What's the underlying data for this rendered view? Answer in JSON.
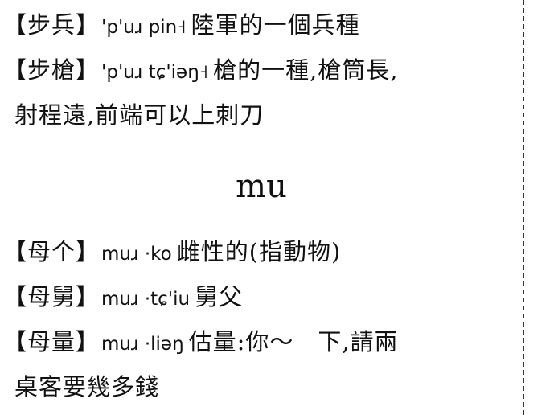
{
  "entries_top": [
    {
      "headword": "【步兵】",
      "pron": "'p'uɹ  pin˧",
      "gloss": "陸軍的一個兵種"
    },
    {
      "headword": "【步槍】",
      "pron": "'p'uɹ  tɕ'iəŋ˧",
      "gloss": "槍的一種,槍筒長,"
    }
  ],
  "entry2_cont": "射程遠,前端可以上刺刀",
  "section_heading": "mu",
  "entries_mu": [
    {
      "headword": "【母个】",
      "pron": "muɹ  ·ko",
      "gloss": "雌性的(指動物)"
    },
    {
      "headword": "【母舅】",
      "pron": "muɹ  ·tɕ'iu",
      "gloss": "舅父"
    },
    {
      "headword": "【母量】",
      "pron": "muɹ  ·liəŋ",
      "gloss": "估量:你～　下,請兩"
    }
  ],
  "entry_mu3_cont": "桌客要幾多錢",
  "right_column_fragments": [
    "【",
    "【",
    "【",
    "【",
    "【"
  ]
}
